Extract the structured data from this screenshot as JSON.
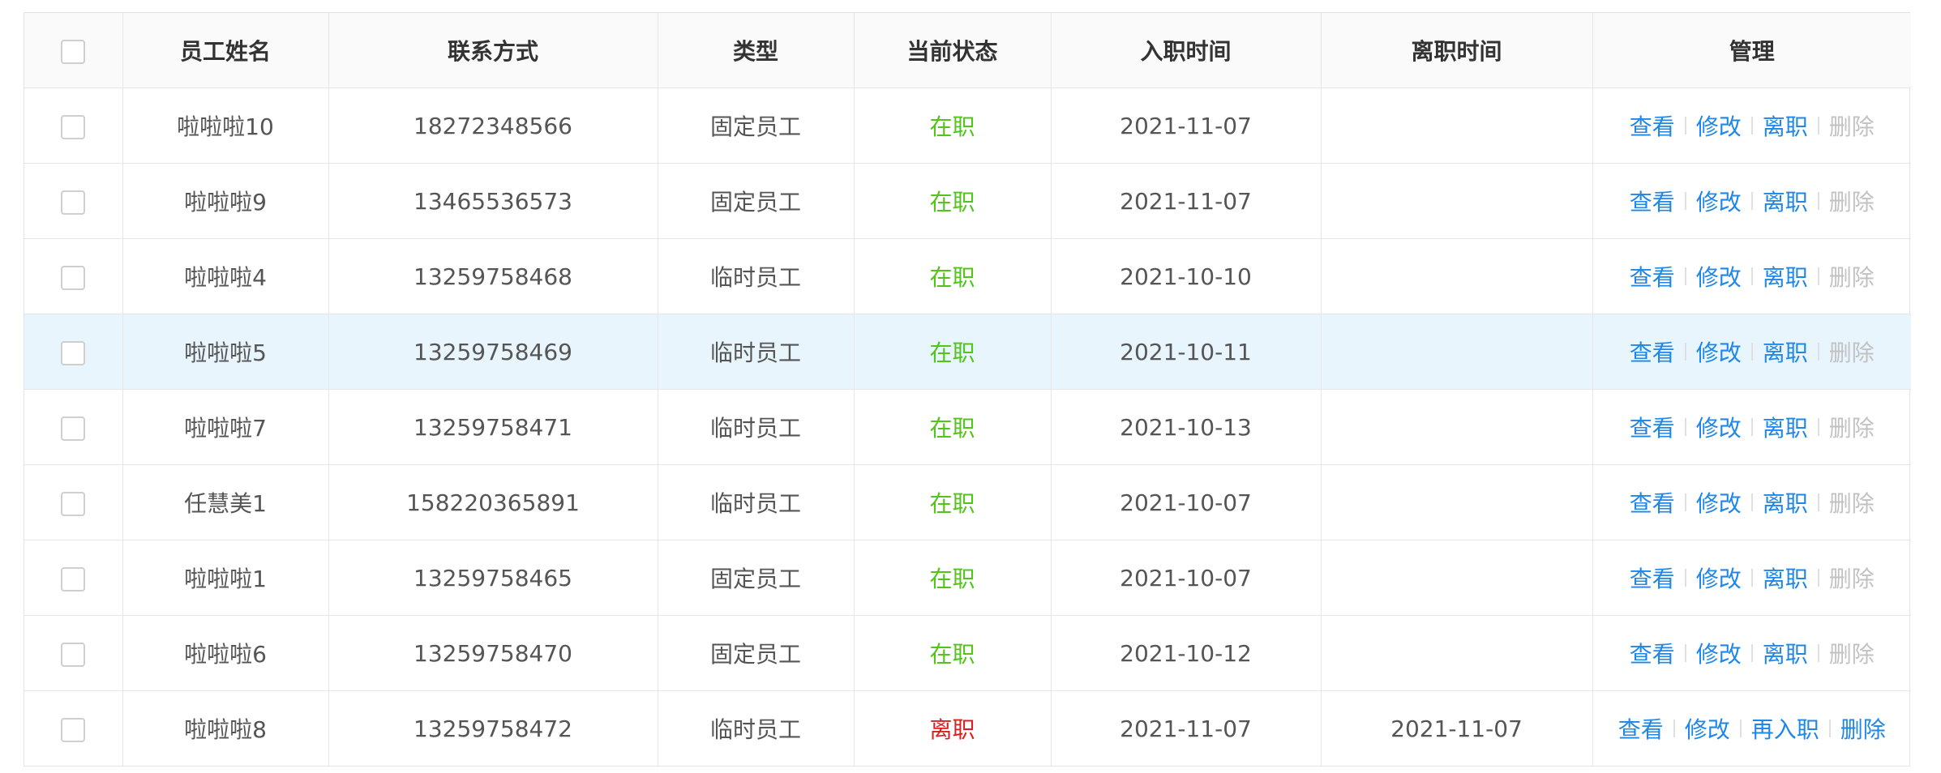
{
  "table": {
    "headers": {
      "name": "员工姓名",
      "contact": "联系方式",
      "type": "类型",
      "status": "当前状态",
      "join_date": "入职时间",
      "leave_date": "离职时间",
      "manage": "管理"
    },
    "rows": [
      {
        "name": "啦啦啦10",
        "contact": "18272348566",
        "type": "固定员工",
        "status": "在职",
        "join_date": "2021-11-07",
        "leave_date": "",
        "actions": {
          "view": "查看",
          "edit": "修改",
          "resign": "离职",
          "delete": "删除"
        }
      },
      {
        "name": "啦啦啦9",
        "contact": "13465536573",
        "type": "固定员工",
        "status": "在职",
        "join_date": "2021-11-07",
        "leave_date": "",
        "actions": {
          "view": "查看",
          "edit": "修改",
          "resign": "离职",
          "delete": "删除"
        }
      },
      {
        "name": "啦啦啦4",
        "contact": "13259758468",
        "type": "临时员工",
        "status": "在职",
        "join_date": "2021-10-10",
        "leave_date": "",
        "actions": {
          "view": "查看",
          "edit": "修改",
          "resign": "离职",
          "delete": "删除"
        }
      },
      {
        "name": "啦啦啦5",
        "contact": "13259758469",
        "type": "临时员工",
        "status": "在职",
        "join_date": "2021-10-11",
        "leave_date": "",
        "actions": {
          "view": "查看",
          "edit": "修改",
          "resign": "离职",
          "delete": "删除"
        }
      },
      {
        "name": "啦啦啦7",
        "contact": "13259758471",
        "type": "临时员工",
        "status": "在职",
        "join_date": "2021-10-13",
        "leave_date": "",
        "actions": {
          "view": "查看",
          "edit": "修改",
          "resign": "离职",
          "delete": "删除"
        }
      },
      {
        "name": "任慧美1",
        "contact": "158220365891",
        "type": "临时员工",
        "status": "在职",
        "join_date": "2021-10-07",
        "leave_date": "",
        "actions": {
          "view": "查看",
          "edit": "修改",
          "resign": "离职",
          "delete": "删除"
        }
      },
      {
        "name": "啦啦啦1",
        "contact": "13259758465",
        "type": "固定员工",
        "status": "在职",
        "join_date": "2021-10-07",
        "leave_date": "",
        "actions": {
          "view": "查看",
          "edit": "修改",
          "resign": "离职",
          "delete": "删除"
        }
      },
      {
        "name": "啦啦啦6",
        "contact": "13259758470",
        "type": "固定员工",
        "status": "在职",
        "join_date": "2021-10-12",
        "leave_date": "",
        "actions": {
          "view": "查看",
          "edit": "修改",
          "resign": "离职",
          "delete": "删除"
        }
      },
      {
        "name": "啦啦啦8",
        "contact": "13259758472",
        "type": "临时员工",
        "status": "离职",
        "join_date": "2021-11-07",
        "leave_date": "2021-11-07",
        "actions": {
          "view": "查看",
          "edit": "修改",
          "rehire": "再入职",
          "delete": "删除"
        }
      }
    ]
  },
  "colors": {
    "status_active": "#52c41a",
    "status_left": "#d9201f",
    "link": "#1f87e8",
    "disabled": "#c2c2c2",
    "row_hover": "#e8f5fd",
    "header_bg": "#fafafa"
  }
}
